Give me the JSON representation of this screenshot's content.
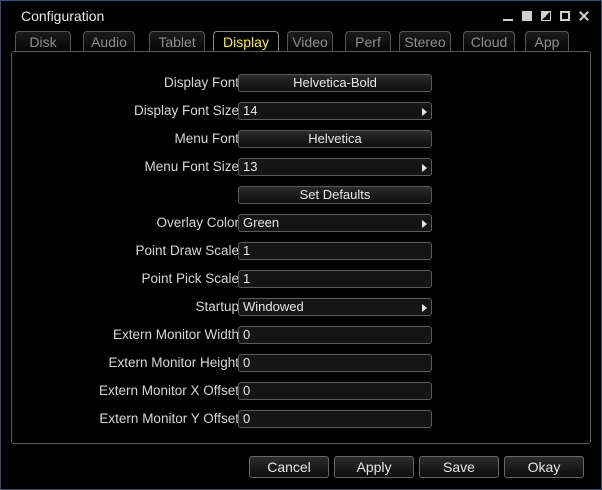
{
  "window": {
    "title": "Configuration"
  },
  "tabs": [
    "Disk",
    "Audio",
    "Tablet",
    "Display",
    "Video",
    "Perf",
    "Stereo",
    "Cloud",
    "App"
  ],
  "active_tab": "Display",
  "fields": [
    {
      "label": "Display Font",
      "value": "Helvetica-Bold",
      "type": "button"
    },
    {
      "label": "Display Font Size",
      "value": "14",
      "type": "dropdown"
    },
    {
      "label": "Menu Font",
      "value": "Helvetica",
      "type": "button"
    },
    {
      "label": "Menu Font Size",
      "value": "13",
      "type": "dropdown"
    },
    {
      "label": "",
      "value": "Set Defaults",
      "type": "button"
    },
    {
      "label": "Overlay Color",
      "value": "Green",
      "type": "dropdown"
    },
    {
      "label": "Point Draw Scale",
      "value": "1",
      "type": "input"
    },
    {
      "label": "Point Pick Scale",
      "value": "1",
      "type": "input"
    },
    {
      "label": "Startup",
      "value": "Windowed",
      "type": "dropdown"
    },
    {
      "label": "Extern Monitor Width",
      "value": "0",
      "type": "input"
    },
    {
      "label": "Extern Monitor Height",
      "value": "0",
      "type": "input"
    },
    {
      "label": "Extern Monitor X Offset",
      "value": "0",
      "type": "input"
    },
    {
      "label": "Extern Monitor Y Offset",
      "value": "0",
      "type": "input"
    }
  ],
  "buttons": {
    "cancel": "Cancel",
    "apply": "Apply",
    "save": "Save",
    "okay": "Okay"
  },
  "colors": {
    "active_tab": "#ffee33",
    "background": "#0a2a8a"
  },
  "icons": [
    "minimize-icon",
    "restore-icon",
    "half-icon",
    "maximize-icon",
    "close-icon",
    "dropdown-arrow-icon"
  ]
}
